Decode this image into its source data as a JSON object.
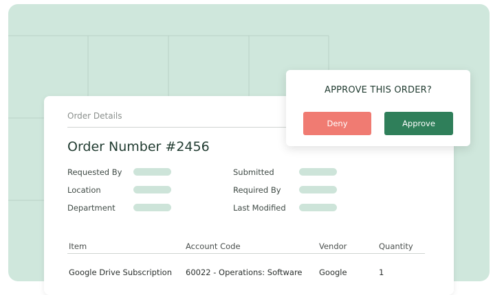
{
  "order": {
    "section_title": "Order Details",
    "number": "Order Number #2456",
    "fields_left": [
      "Requested By",
      "Location",
      "Department"
    ],
    "fields_right": [
      "Submitted",
      "Required By",
      "Last Modified"
    ],
    "table": {
      "headers": [
        "Item",
        "Account Code",
        "Vendor",
        "Quantity"
      ],
      "rows": [
        [
          "Google Drive Subscription",
          "60022 - Operations: Software",
          "Google",
          "1"
        ]
      ]
    }
  },
  "approval": {
    "title": "APPROVE THIS ORDER?",
    "deny_label": "Deny",
    "approve_label": "Approve"
  },
  "colors": {
    "background": "#cfe7dc",
    "deny": "#f07b72",
    "approve": "#2f7f5a",
    "placeholder_pill": "#cde4d9"
  }
}
